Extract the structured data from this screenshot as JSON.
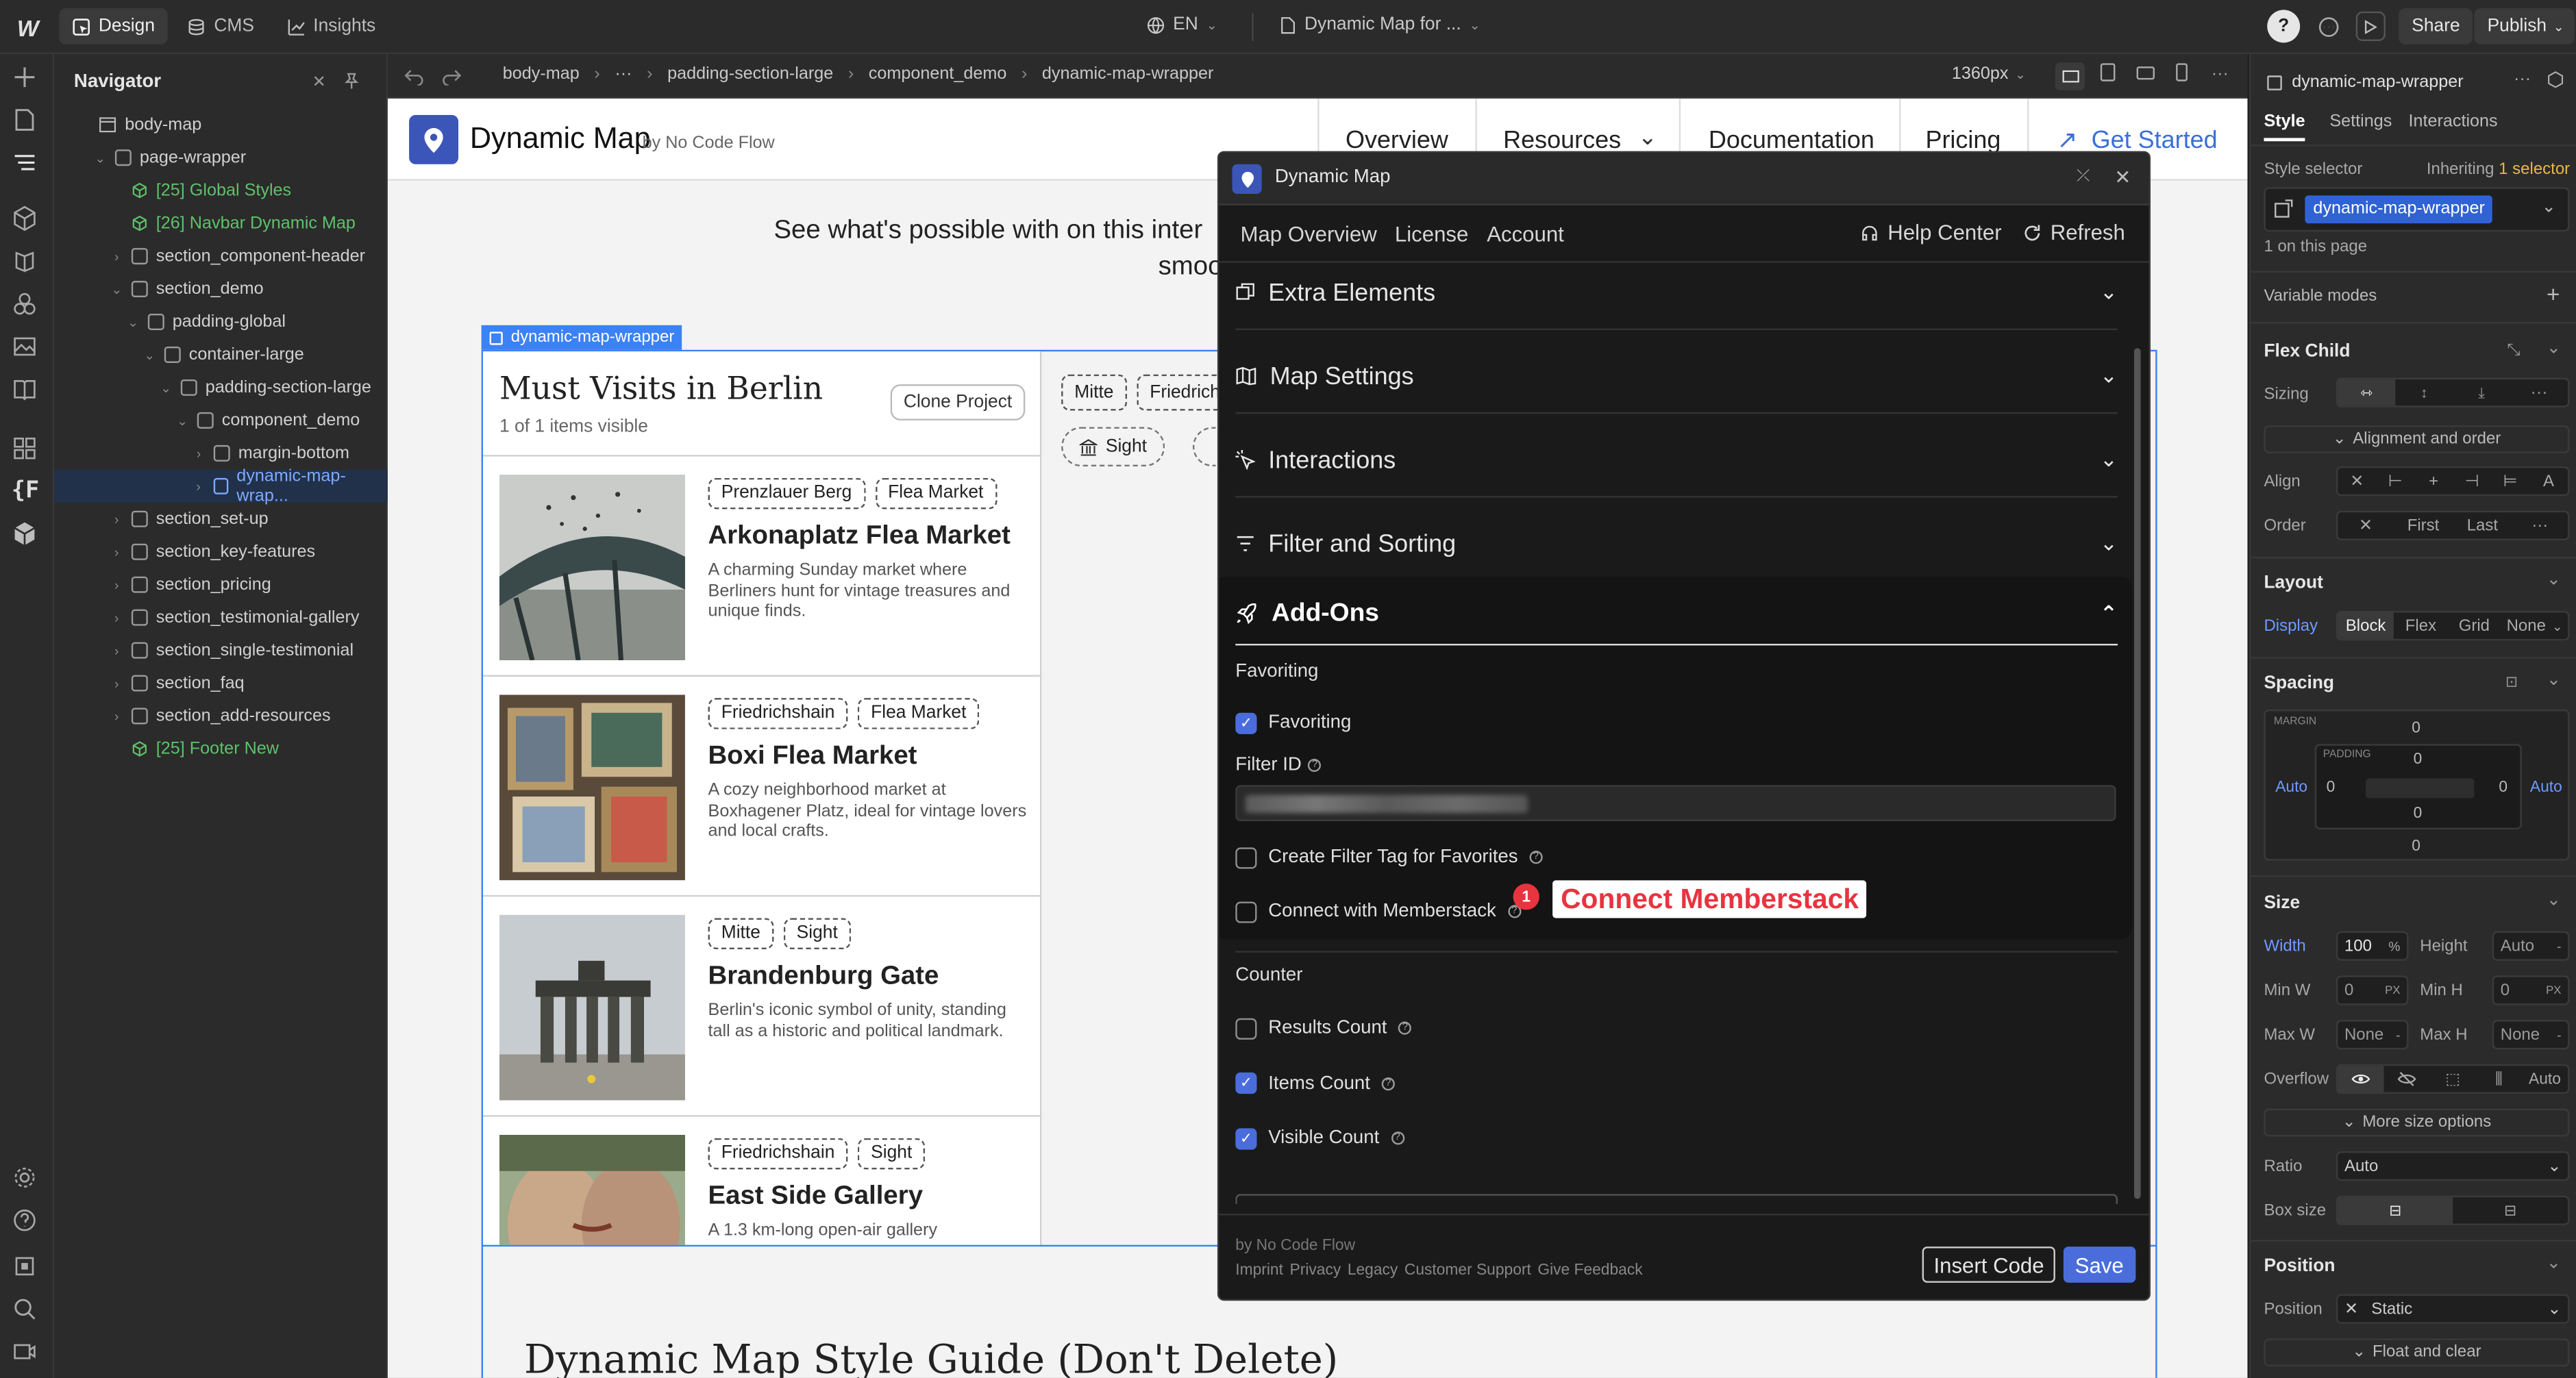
{
  "topbar": {
    "logo": "W",
    "tabs": [
      {
        "label": "Design",
        "icon": "pointer-icon"
      },
      {
        "label": "CMS",
        "icon": "database-icon"
      },
      {
        "label": "Insights",
        "icon": "chart-icon"
      }
    ],
    "locale": "EN",
    "page_name": "Dynamic Map for ...",
    "share_label": "Share",
    "publish_label": "Publish"
  },
  "navigator": {
    "title": "Navigator",
    "tree": [
      {
        "label": "body-map",
        "depth": 0,
        "kind": "page",
        "chev": ""
      },
      {
        "label": "page-wrapper",
        "depth": 1,
        "kind": "box",
        "chev": "v"
      },
      {
        "label": "[25] Global Styles",
        "depth": 2,
        "kind": "sym",
        "chev": ""
      },
      {
        "label": "[26] Navbar Dynamic Map",
        "depth": 2,
        "kind": "sym",
        "chev": ""
      },
      {
        "label": "section_component-header",
        "depth": 2,
        "kind": "box",
        "chev": ">"
      },
      {
        "label": "section_demo",
        "depth": 2,
        "kind": "box",
        "chev": "v"
      },
      {
        "label": "padding-global",
        "depth": 3,
        "kind": "box",
        "chev": "v"
      },
      {
        "label": "container-large",
        "depth": 4,
        "kind": "box",
        "chev": "v"
      },
      {
        "label": "padding-section-large",
        "depth": 5,
        "kind": "box",
        "chev": "v"
      },
      {
        "label": "component_demo",
        "depth": 6,
        "kind": "box",
        "chev": "v"
      },
      {
        "label": "margin-bottom",
        "depth": 7,
        "kind": "box",
        "chev": ">"
      },
      {
        "label": "dynamic-map-wrap...",
        "depth": 7,
        "kind": "sel",
        "chev": ">"
      },
      {
        "label": "section_set-up",
        "depth": 2,
        "kind": "box",
        "chev": ">"
      },
      {
        "label": "section_key-features",
        "depth": 2,
        "kind": "box",
        "chev": ">"
      },
      {
        "label": "section_pricing",
        "depth": 2,
        "kind": "box",
        "chev": ">"
      },
      {
        "label": "section_testimonial-gallery",
        "depth": 2,
        "kind": "box",
        "chev": ">"
      },
      {
        "label": "section_single-testimonial",
        "depth": 2,
        "kind": "box",
        "chev": ">"
      },
      {
        "label": "section_faq",
        "depth": 2,
        "kind": "box",
        "chev": ">"
      },
      {
        "label": "section_add-resources",
        "depth": 2,
        "kind": "box",
        "chev": ">"
      },
      {
        "label": "[25] Footer New",
        "depth": 2,
        "kind": "sym",
        "chev": ""
      }
    ]
  },
  "breadcrumb": {
    "items": [
      "body-map",
      "···",
      "padding-section-large",
      "component_demo",
      "dynamic-map-wrapper"
    ],
    "viewport": "1360px"
  },
  "site": {
    "brand": "Dynamic Map",
    "brand_by": "by No Code Flow",
    "nav": [
      "Overview",
      "Resources",
      "Documentation",
      "Pricing"
    ],
    "cta": "Get Started",
    "hero_line1": "See what's possible with on this inter",
    "hero_line2": "smoo",
    "selection_label": "dynamic-map-wrapper",
    "list_title": "Must Visits in Berlin",
    "list_count": "1 of 1 items visible",
    "clone_label": "Clone Project",
    "filter_tags": [
      "Mitte",
      "Friedrich"
    ],
    "filter_sight": "Sight",
    "style_guide_title": "Dynamic Map Style Guide (Don't Delete)",
    "cards": [
      {
        "tags": [
          "Prenzlauer Berg",
          "Flea Market"
        ],
        "title": "Arkonaplatz Flea Market",
        "desc": "A charming Sunday market where Berliners hunt for vintage treasures and unique finds."
      },
      {
        "tags": [
          "Friedrichshain",
          "Flea Market"
        ],
        "title": "Boxi Flea Market",
        "desc": "A cozy neighborhood market at Boxhagener Platz, ideal for vintage lovers and local crafts."
      },
      {
        "tags": [
          "Mitte",
          "Sight"
        ],
        "title": "Brandenburg Gate",
        "desc": "Berlin's iconic symbol of unity, standing tall as a historic and political landmark."
      },
      {
        "tags": [
          "Friedrichshain",
          "Sight"
        ],
        "title": "East Side Gallery",
        "desc": "A 1.3 km-long open-air gallery"
      }
    ]
  },
  "dialog": {
    "title": "Dynamic Map",
    "menu": [
      "Map Overview",
      "License",
      "Account"
    ],
    "help_center": "Help Center",
    "refresh": "Refresh",
    "sections": [
      "Extra Elements",
      "Map Settings",
      "Interactions",
      "Filter and Sorting"
    ],
    "addons_title": "Add-Ons",
    "favoriting_group": "Favoriting",
    "favoriting_label": "Favoriting",
    "favoriting_checked": true,
    "filter_id_label": "Filter ID",
    "create_tag_label": "Create Filter Tag for Favorites",
    "create_tag_checked": false,
    "memberstack_label": "Connect with Memberstack",
    "memberstack_checked": false,
    "badge_count": "1",
    "memberstack_button": "Connect Memberstack",
    "counter_group": "Counter",
    "counters": [
      {
        "label": "Results Count",
        "checked": false
      },
      {
        "label": "Items Count",
        "checked": true
      },
      {
        "label": "Visible Count",
        "checked": true
      }
    ],
    "footer_by": "by No Code Flow",
    "footer_links": [
      "Imprint",
      "Privacy",
      "Legacy",
      "Customer Support",
      "Give Feedback"
    ],
    "insert_code": "Insert Code",
    "save": "Save"
  },
  "right_panel": {
    "element_name": "dynamic-map-wrapper",
    "tabs": [
      "Style",
      "Settings",
      "Interactions"
    ],
    "style_selector": "Style selector",
    "inheriting": "Inheriting",
    "inheriting_count": "1 selector",
    "selector_chip": "dynamic-map-wrapper",
    "on_page": "1 on this page",
    "variable_modes": "Variable modes",
    "flex_child": "Flex Child",
    "sizing": "Sizing",
    "alignment_order": "Alignment and order",
    "align": "Align",
    "order": "Order",
    "order_first": "First",
    "order_last": "Last",
    "layout": "Layout",
    "display": "Display",
    "display_options": [
      "Block",
      "Flex",
      "Grid",
      "None"
    ],
    "spacing": "Spacing",
    "margin_label": "MARGIN",
    "padding_label": "PADDING",
    "margin_top": "0",
    "margin_bottom": "0",
    "margin_left": "Auto",
    "margin_right": "Auto",
    "padding_top": "0",
    "padding_bottom": "0",
    "padding_left": "0",
    "padding_right": "0",
    "size": "Size",
    "width_label": "Width",
    "width_value": "100",
    "width_unit": "%",
    "height_label": "Height",
    "height_value": "Auto",
    "minw_label": "Min W",
    "minw_value": "0",
    "minw_unit": "PX",
    "minh_label": "Min H",
    "minh_value": "0",
    "minh_unit": "PX",
    "maxw_label": "Max W",
    "maxw_value": "None",
    "maxh_label": "Max H",
    "maxh_value": "None",
    "overflow_label": "Overflow",
    "overflow_auto": "Auto",
    "more_size": "More size options",
    "ratio_label": "Ratio",
    "ratio_value": "Auto",
    "boxsize_label": "Box size",
    "position": "Position",
    "position_label": "Position",
    "position_value": "Static",
    "float_clear": "Float and clear"
  },
  "colors": {
    "accent": "#4a6ddb",
    "symbol_green": "#5ec16b",
    "memberstack_red": "#e8343f",
    "selection_blue": "#3b82f6"
  }
}
